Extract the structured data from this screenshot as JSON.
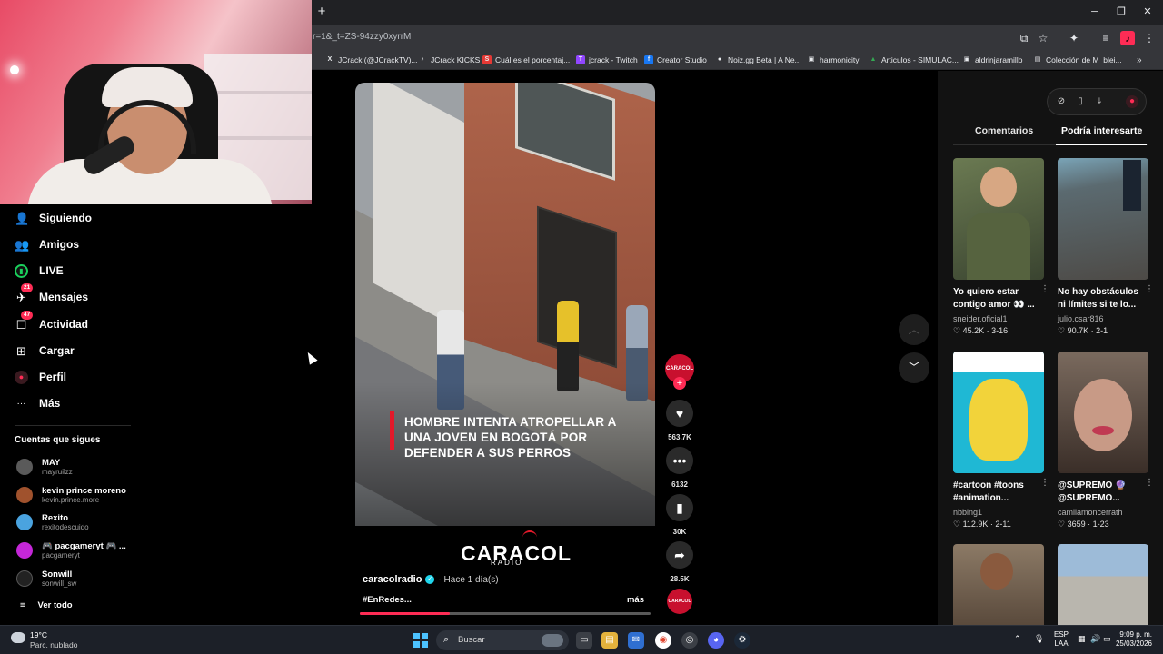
{
  "browser": {
    "url": "r=1&_t=ZS-94zzy0xyrrM",
    "bookmarks": [
      {
        "label": "JCrack (@JCrackTV)...",
        "icon": "x-icon",
        "color": "#000000",
        "glyph": "X"
      },
      {
        "label": "JCrack KICKS",
        "icon": "tiktok-icon",
        "color": "#000000",
        "glyph": "♪"
      },
      {
        "label": "Cuál es el porcentaj...",
        "icon": "s-icon",
        "color": "#e53935",
        "glyph": "S"
      },
      {
        "label": "jcrack - Twitch",
        "icon": "twitch-icon",
        "color": "#9146ff",
        "glyph": "T"
      },
      {
        "label": "Creator Studio",
        "icon": "facebook-icon",
        "color": "#1877f2",
        "glyph": "f"
      },
      {
        "label": "Noiz.gg Beta | A Ne...",
        "icon": "noiz-icon",
        "color": "#444444",
        "glyph": "●"
      },
      {
        "label": "harmonicity",
        "icon": "image-icon",
        "color": "#888888",
        "glyph": "▣"
      },
      {
        "label": "Articulos - SIMULAC...",
        "icon": "drive-icon",
        "color": "#34a853",
        "glyph": "▲"
      },
      {
        "label": "aldrinjaramillo",
        "icon": "image-icon",
        "color": "#888888",
        "glyph": "▣"
      },
      {
        "label": "Colección de M_blei...",
        "icon": "doc-icon",
        "color": "#666666",
        "glyph": "▤"
      }
    ]
  },
  "sidebar": {
    "items": [
      {
        "label": "Siguiendo",
        "icon": "following-icon",
        "glyph": "👤",
        "badge": ""
      },
      {
        "label": "Amigos",
        "icon": "friends-icon",
        "glyph": "👥",
        "badge": ""
      },
      {
        "label": "LIVE",
        "icon": "live-icon",
        "glyph": "▮",
        "badge": ""
      },
      {
        "label": "Mensajes",
        "icon": "messages-icon",
        "glyph": "✈",
        "badge": "21"
      },
      {
        "label": "Actividad",
        "icon": "activity-icon",
        "glyph": "☐",
        "badge": "47"
      },
      {
        "label": "Cargar",
        "icon": "upload-icon",
        "glyph": "⊞",
        "badge": ""
      },
      {
        "label": "Perfil",
        "icon": "profile-icon",
        "glyph": "●",
        "badge": ""
      },
      {
        "label": "Más",
        "icon": "more-icon",
        "glyph": "···",
        "badge": ""
      }
    ],
    "following_title": "Cuentas que sigues",
    "accounts": [
      {
        "name": "MAY",
        "handle": "mayruilzz",
        "color": "#5a5a5a"
      },
      {
        "name": "kevin prince moreno",
        "handle": "kevin.prince.more",
        "color": "#a0522d"
      },
      {
        "name": "Rexito",
        "handle": "rexitodescuido",
        "color": "#4aa3df"
      },
      {
        "name": "🎮 pacgameryt 🎮 ...",
        "handle": "pacgameryt",
        "color": "#c427d8"
      },
      {
        "name": "Sonwill",
        "handle": "sonwill_sw",
        "color": "#222222"
      }
    ],
    "see_all": "Ver todo"
  },
  "video": {
    "caption": "HOMBRE INTENTA ATROPELLAR A UNA JOVEN EN BOGOTÁ POR DEFENDER A SUS PERROS",
    "caption_lines": [
      "HOMBRE INTENTA ATROPELLAR A",
      "UNA JOVEN EN BOGOTÁ POR",
      "DEFENDER A SUS PERROS"
    ],
    "logo": "CARACOL",
    "logo_sub": "RADIO",
    "author": "caracolradio",
    "time": "· Hace 1 día(s)",
    "hashtag": "#EnRedes...",
    "more": "más",
    "progress": 0.31
  },
  "actions": {
    "avatar_label": "CARACOL",
    "likes": "563.7K",
    "comments": "6132",
    "saves": "30K",
    "shares": "28.5K"
  },
  "right_panel": {
    "tabs": [
      "Comentarios",
      "Podría interesarte"
    ],
    "active_tab": 1,
    "cards": [
      {
        "title": "Yo quiero estar contigo amor 👀 ...",
        "author": "sneider.oficial1",
        "stats": "♡ 45.2K · 3-16",
        "bg": "#4b5a3a"
      },
      {
        "title": "No hay obstáculos ni límites si te lo...",
        "author": "julio.csar816",
        "stats": "♡ 90.7K · 2-1",
        "bg": "#5d6e78"
      },
      {
        "title": "#cartoon #toons #animation...",
        "author": "nbbing1",
        "stats": "♡ 112.9K · 2-11",
        "bg": "#1fb8d4"
      },
      {
        "title": "@SUPREMO 🔮 @SUPREMO...",
        "author": "camilamoncerrath",
        "stats": "♡ 3659 · 1-23",
        "bg": "#6b5548"
      },
      {
        "title": "",
        "author": "",
        "stats": "",
        "bg": "#7a6a5a"
      },
      {
        "title": "",
        "author": "",
        "stats": "",
        "bg": "#8fa8bf"
      }
    ]
  },
  "taskbar": {
    "temp": "19°C",
    "weather": "Parc. nublado",
    "search": "Buscar",
    "lang1": "ESP",
    "lang2": "LAA",
    "time": "9:09 p. m.",
    "date": "25/03/2026"
  }
}
